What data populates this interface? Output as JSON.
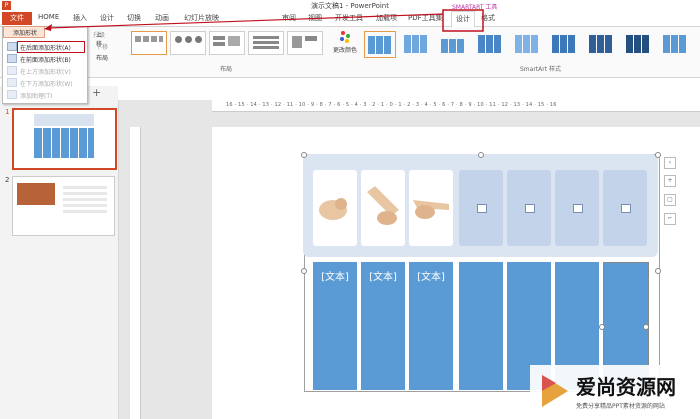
{
  "window": {
    "title": "演示文稿1 - PowerPoint",
    "app_icon": "P"
  },
  "tabs": [
    {
      "label": "文件"
    },
    {
      "label": "HOME"
    },
    {
      "label": "插入"
    },
    {
      "label": "设计"
    },
    {
      "label": "切换"
    },
    {
      "label": "动画"
    },
    {
      "label": "幻灯片放映"
    },
    {
      "label": "审阅"
    },
    {
      "label": "视图"
    },
    {
      "label": "开发工具"
    },
    {
      "label": "加载项"
    },
    {
      "label": "PDF工具集"
    },
    {
      "label": "设计"
    },
    {
      "label": "格式"
    }
  ],
  "context_tab_header": "SMARTART 工具",
  "dropdown": {
    "head": "添加形状",
    "items": [
      {
        "label": "在后面添加形状(A)",
        "disabled": false
      },
      {
        "label": "在前面添加形状(B)",
        "disabled": false
      },
      {
        "label": "在上方添加形状(V)",
        "disabled": true
      },
      {
        "label": "在下方添加形状(W)",
        "disabled": true
      },
      {
        "label": "添加助理(T)",
        "disabled": true
      }
    ]
  },
  "ribbon": {
    "promote": "升级",
    "move_up": "上移",
    "move_down": "下移",
    "layout_btn": "布局",
    "change_colors": "更改颜色",
    "group_layouts": "布局",
    "group_styles": "SmartArt 样式"
  },
  "slides": [
    {
      "number": "1"
    },
    {
      "number": "2"
    }
  ],
  "ruler": {
    "marks": "16 · 15 · 14 · 13 · 12 · 11 · 10 · 9 · 8 · 7 · 6 · 5 · 4 · 3 · 2 · 1 · 0 · 1 · 2 · 3 · 4 · 5 · 6 · 7 · 8 · 9 · 10 · 11 · 12 · 13 · 14 · 15 · 16"
  },
  "smartart": {
    "text_placeholder": "[文本]",
    "columns": 7,
    "picture_columns": 3
  },
  "colors": {
    "accent_file": "#d24726",
    "smartart_blue": "#5b9bd5",
    "placeholder_blue": "#c3d3ea",
    "annotation_red": "#c0101e"
  },
  "watermark": {
    "title": "爱尚资源网",
    "subtitle": "免费分享精品PPT素材资源的网站"
  }
}
